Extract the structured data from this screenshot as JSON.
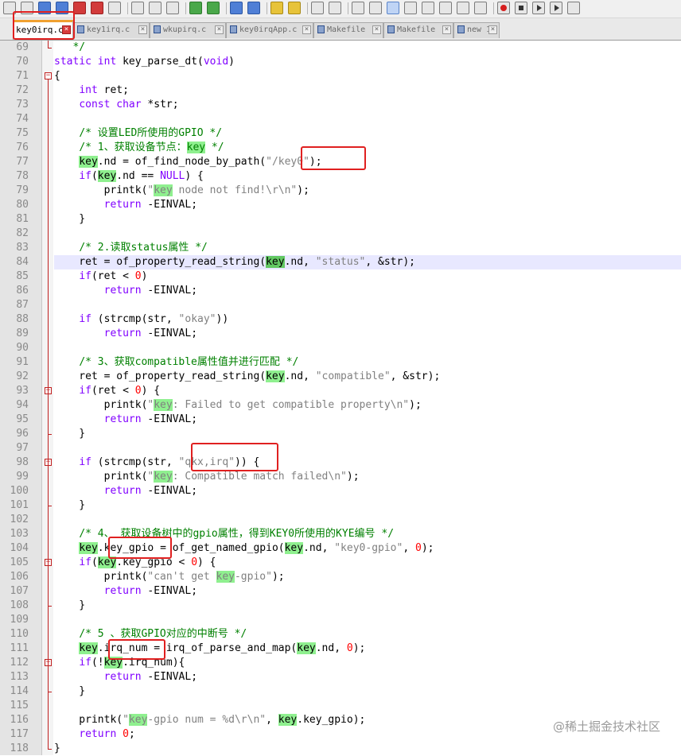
{
  "tabs": [
    {
      "label": "key0irq.c",
      "active": true
    },
    {
      "label": "key1irq.c",
      "active": false
    },
    {
      "label": "wkupirq.c",
      "active": false
    },
    {
      "label": "key0irqApp.c",
      "active": false
    },
    {
      "label": "Makefile",
      "active": false
    },
    {
      "label": "Makefile",
      "active": false
    },
    {
      "label": "new 1",
      "active": false
    }
  ],
  "editor": {
    "current_line": 84,
    "lines": [
      {
        "n": 69,
        "text": "   */"
      },
      {
        "n": 70,
        "text": "static int key_parse_dt(void)"
      },
      {
        "n": 71,
        "text": "{"
      },
      {
        "n": 72,
        "text": "    int ret;"
      },
      {
        "n": 73,
        "text": "    const char *str;"
      },
      {
        "n": 74,
        "text": ""
      },
      {
        "n": 75,
        "text": "    /* 设置LED所使用的GPIO */"
      },
      {
        "n": 76,
        "text": "    /* 1、获取设备节点：key */"
      },
      {
        "n": 77,
        "text": "    key.nd = of_find_node_by_path(\"/key0\");"
      },
      {
        "n": 78,
        "text": "    if(key.nd == NULL) {"
      },
      {
        "n": 79,
        "text": "        printk(\"key node not find!\\r\\n\");"
      },
      {
        "n": 80,
        "text": "        return -EINVAL;"
      },
      {
        "n": 81,
        "text": "    }"
      },
      {
        "n": 82,
        "text": ""
      },
      {
        "n": 83,
        "text": "    /* 2.读取status属性 */"
      },
      {
        "n": 84,
        "text": "    ret = of_property_read_string(key.nd, \"status\", &str);"
      },
      {
        "n": 85,
        "text": "    if(ret < 0)"
      },
      {
        "n": 86,
        "text": "        return -EINVAL;"
      },
      {
        "n": 87,
        "text": ""
      },
      {
        "n": 88,
        "text": "    if (strcmp(str, \"okay\"))"
      },
      {
        "n": 89,
        "text": "        return -EINVAL;"
      },
      {
        "n": 90,
        "text": ""
      },
      {
        "n": 91,
        "text": "    /* 3、获取compatible属性值并进行匹配 */"
      },
      {
        "n": 92,
        "text": "    ret = of_property_read_string(key.nd, \"compatible\", &str);"
      },
      {
        "n": 93,
        "text": "    if(ret < 0) {"
      },
      {
        "n": 94,
        "text": "        printk(\"key: Failed to get compatible property\\n\");"
      },
      {
        "n": 95,
        "text": "        return -EINVAL;"
      },
      {
        "n": 96,
        "text": "    }"
      },
      {
        "n": 97,
        "text": ""
      },
      {
        "n": 98,
        "text": "    if (strcmp(str, \"qkx,irq\")) {"
      },
      {
        "n": 99,
        "text": "        printk(\"key: Compatible match failed\\n\");"
      },
      {
        "n": 100,
        "text": "        return -EINVAL;"
      },
      {
        "n": 101,
        "text": "    }"
      },
      {
        "n": 102,
        "text": ""
      },
      {
        "n": 103,
        "text": "    /* 4、 获取设备树中的gpio属性，得到KEY0所使用的KYE编号 */"
      },
      {
        "n": 104,
        "text": "    key.key_gpio = of_get_named_gpio(key.nd, \"key0-gpio\", 0);"
      },
      {
        "n": 105,
        "text": "    if(key.key_gpio < 0) {"
      },
      {
        "n": 106,
        "text": "        printk(\"can't get key-gpio\");"
      },
      {
        "n": 107,
        "text": "        return -EINVAL;"
      },
      {
        "n": 108,
        "text": "    }"
      },
      {
        "n": 109,
        "text": ""
      },
      {
        "n": 110,
        "text": "    /* 5 、获取GPIO对应的中断号 */"
      },
      {
        "n": 111,
        "text": "    key.irq_num = irq_of_parse_and_map(key.nd, 0);"
      },
      {
        "n": 112,
        "text": "    if(!key.irq_num){"
      },
      {
        "n": 113,
        "text": "        return -EINVAL;"
      },
      {
        "n": 114,
        "text": "    }"
      },
      {
        "n": 115,
        "text": ""
      },
      {
        "n": 116,
        "text": "    printk(\"key-gpio num = %d\\r\\n\", key.key_gpio);"
      },
      {
        "n": 117,
        "text": "    return 0;"
      },
      {
        "n": 118,
        "text": "}"
      }
    ]
  },
  "highlight_word": "key",
  "watermark": "@稀土掘金技术社区",
  "colors": {
    "keyword": "#8000ff",
    "comment": "#008000",
    "string": "#808080",
    "number": "#ff0000",
    "word_highlight": "#8ff08f",
    "annotation_box": "#e02020",
    "current_line": "#e8e8ff"
  }
}
